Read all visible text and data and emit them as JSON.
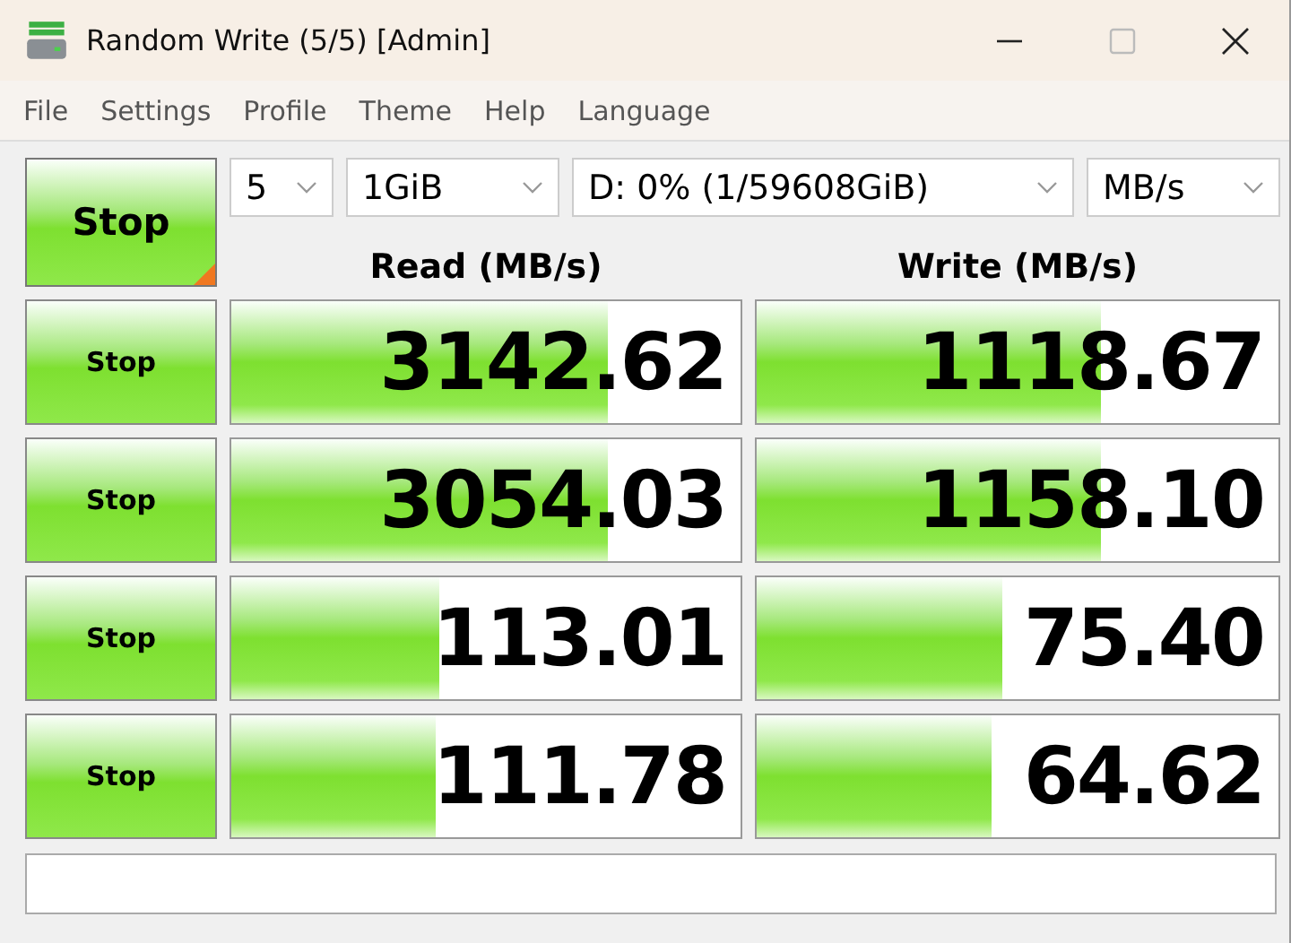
{
  "window": {
    "title": "Random Write (5/5) [Admin]"
  },
  "menu": [
    "File",
    "Settings",
    "Profile",
    "Theme",
    "Help",
    "Language"
  ],
  "all_button": {
    "label": "Stop"
  },
  "selectors": [
    {
      "value": "5"
    },
    {
      "value": "1GiB"
    },
    {
      "value": "D: 0% (1/59608GiB)"
    },
    {
      "value": "MB/s"
    }
  ],
  "headers": {
    "read": "Read (MB/s)",
    "write": "Write (MB/s)"
  },
  "rows": [
    {
      "button": "Stop",
      "read": {
        "value": "3142.62",
        "level": 0.74
      },
      "write": {
        "value": "1118.67",
        "level": 0.66
      }
    },
    {
      "button": "Stop",
      "read": {
        "value": "3054.03",
        "level": 0.74
      },
      "write": {
        "value": "1158.10",
        "level": 0.66
      }
    },
    {
      "button": "Stop",
      "read": {
        "value": "113.01",
        "level": 0.41
      },
      "write": {
        "value": "75.40",
        "level": 0.47
      }
    },
    {
      "button": "Stop",
      "read": {
        "value": "111.78",
        "level": 0.4
      },
      "write": {
        "value": "64.62",
        "level": 0.45
      }
    }
  ]
}
